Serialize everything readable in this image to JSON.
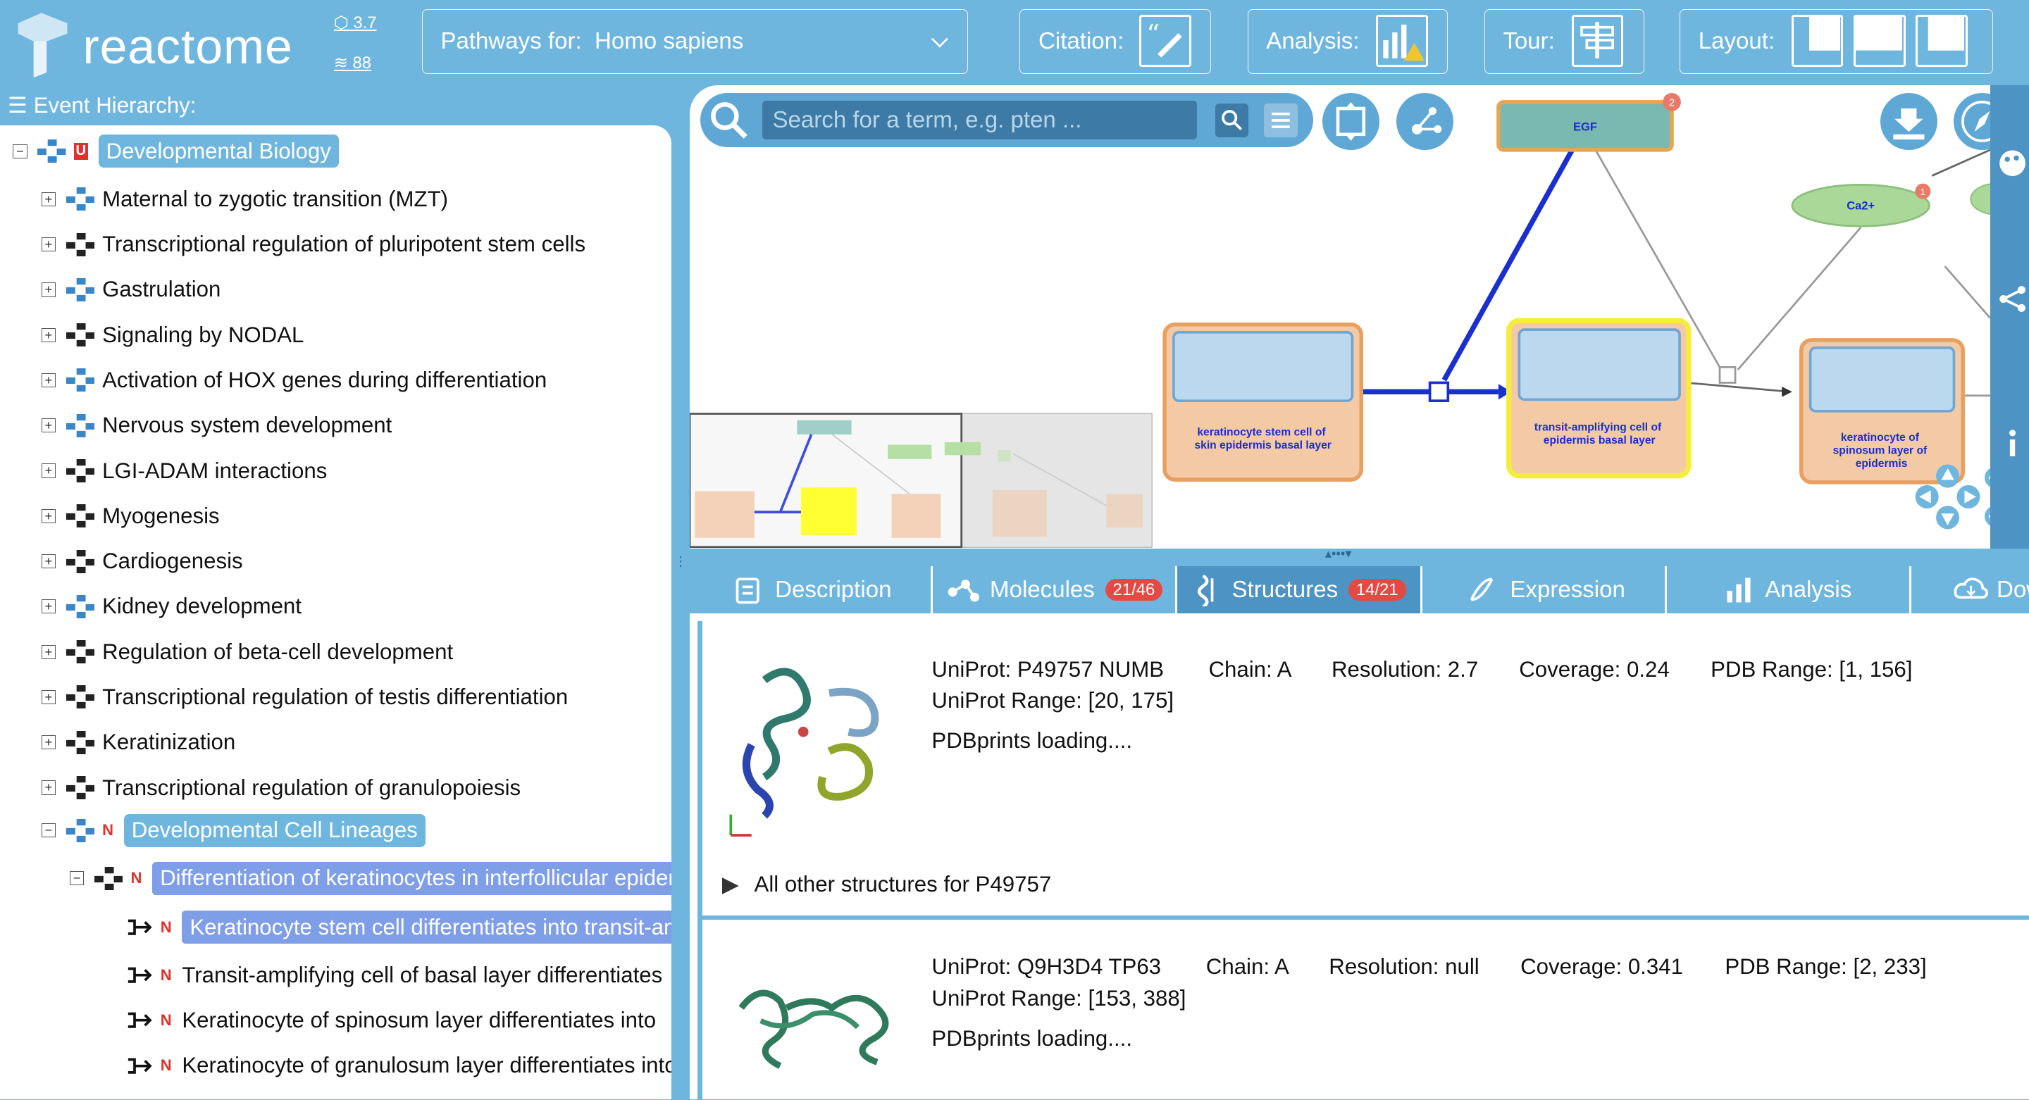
{
  "app": {
    "name": "reactome",
    "version": "3.7",
    "db_version": "88"
  },
  "header": {
    "species_label": "Pathways for:",
    "species_value": "Homo sapiens",
    "citation_label": "Citation:",
    "analysis_label": "Analysis:",
    "tour_label": "Tour:",
    "layout_label": "Layout:"
  },
  "hierarchy": {
    "title": "Event Hierarchy:",
    "root": {
      "label": "Developmental Biology",
      "badge": "U"
    },
    "children": [
      {
        "label": "Maternal to zygotic transition (MZT)",
        "icon": "pathway"
      },
      {
        "label": "Transcriptional regulation of pluripotent stem cells",
        "icon": "subpathway"
      },
      {
        "label": "Gastrulation",
        "icon": "pathway"
      },
      {
        "label": "Signaling by NODAL",
        "icon": "subpathway"
      },
      {
        "label": "Activation of HOX genes during differentiation",
        "icon": "pathway"
      },
      {
        "label": "Nervous system development",
        "icon": "pathway"
      },
      {
        "label": "LGI-ADAM interactions",
        "icon": "subpathway"
      },
      {
        "label": "Myogenesis",
        "icon": "subpathway"
      },
      {
        "label": "Cardiogenesis",
        "icon": "subpathway"
      },
      {
        "label": "Kidney development",
        "icon": "pathway"
      },
      {
        "label": "Regulation of beta-cell development",
        "icon": "subpathway"
      },
      {
        "label": "Transcriptional regulation of testis differentiation",
        "icon": "subpathway"
      },
      {
        "label": "Keratinization",
        "icon": "subpathway"
      },
      {
        "label": "Transcriptional regulation of granulopoiesis",
        "icon": "subpathway"
      }
    ],
    "lineage": {
      "label": "Developmental Cell Lineages",
      "badge": "N"
    },
    "subpathway": {
      "label": "Differentiation of keratinocytes in interfollicular epidermis",
      "badge": "N"
    },
    "reactions": [
      {
        "label": "Keratinocyte stem cell differentiates into transit-amplifying cell",
        "badge": "N",
        "selected": true
      },
      {
        "label": "Transit-amplifying cell of basal layer differentiates",
        "badge": "N"
      },
      {
        "label": "Keratinocyte of spinosum layer differentiates into",
        "badge": "N"
      },
      {
        "label": "Keratinocyte of granulosum layer differentiates into",
        "badge": "N"
      }
    ]
  },
  "diagram": {
    "search_placeholder": "Search for a term, e.g. pten ...",
    "nodes": {
      "egf": "EGF",
      "ca2": "Ca2+",
      "stem_cell": "keratinocyte stem cell of skin epidermis basal layer",
      "transit_cell": "transit-amplifying cell of epidermis basal layer",
      "spinosum_cell": "keratinocyte of spinosum layer of epidermis"
    },
    "badges": {
      "egf": "2",
      "ca2": "1"
    }
  },
  "tabs": [
    {
      "label": "Description",
      "icon": "clipboard-icon"
    },
    {
      "label": "Molecules",
      "icon": "molecules-icon",
      "count": "21/46"
    },
    {
      "label": "Structures",
      "icon": "structure-icon",
      "count": "14/21",
      "active": true
    },
    {
      "label": "Expression",
      "icon": "dna-icon"
    },
    {
      "label": "Analysis",
      "icon": "bar-chart-icon"
    },
    {
      "label": "Download",
      "icon": "cloud-download-icon"
    }
  ],
  "structures": [
    {
      "uniprot": "UniProt: P49757 NUMB",
      "chain": "Chain: A",
      "resolution": "Resolution: 2.7",
      "coverage": "Coverage: 0.24",
      "pdb_range": "PDB Range: [1, 156]",
      "uniprot_range": "UniProt Range: [20, 175]",
      "status": "PDBprints loading....",
      "other": "All other structures for P49757"
    },
    {
      "uniprot": "UniProt: Q9H3D4 TP63",
      "chain": "Chain: A",
      "resolution": "Resolution: null",
      "coverage": "Coverage: 0.341",
      "pdb_range": "PDB Range: [2, 233]",
      "uniprot_range": "UniProt Range: [153, 388]",
      "status": "PDBprints loading...."
    }
  ],
  "colors": {
    "brand": "#6fb6df",
    "accent_dark": "#4d93c4",
    "highlight": "#7f9ee8",
    "badge_red": "#e44a43"
  }
}
